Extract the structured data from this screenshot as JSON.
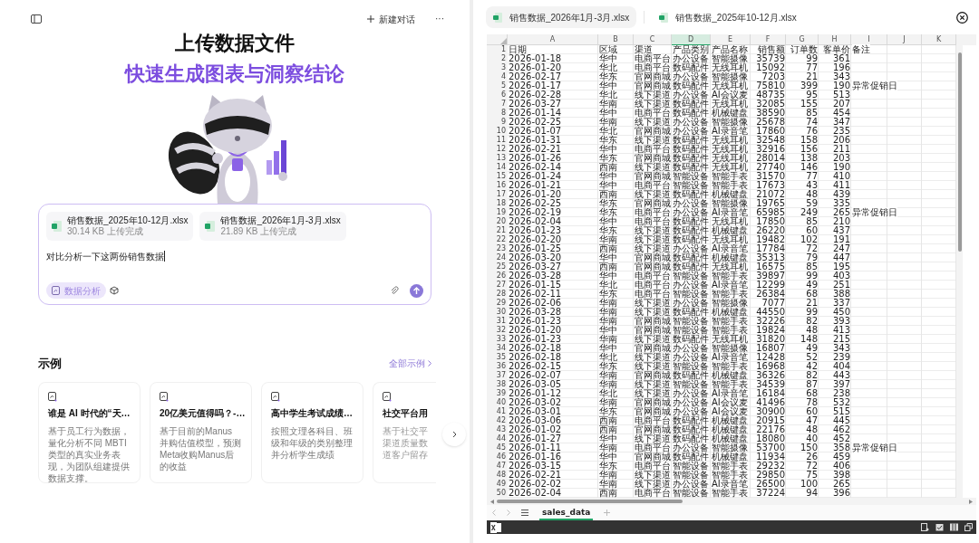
{
  "header": {
    "new_chat": "新建对话",
    "more": "···"
  },
  "hero": {
    "title": "上传数据文件",
    "subtitle": "快速生成图表与洞察结论"
  },
  "composer": {
    "files": [
      {
        "name": "销售数据_2025年10-12月.xlsx",
        "status": "30.14 KB 上传完成"
      },
      {
        "name": "销售数据_2026年1月-3月.xlsx",
        "status": "21.89 KB 上传完成"
      }
    ],
    "message": "对比分析一下这两份销售数据",
    "mode": {
      "label": "数据分析",
      "selected": true
    }
  },
  "examples": {
    "title": "示例",
    "all_link": "全部示例",
    "cards": [
      {
        "title": "谁是 AI 时代的“天…",
        "description": "基于员工行为数据，量化分析不同 MBTI 类型的真实业务表现，为团队组建提供数据支撑。"
      },
      {
        "title": "20亿美元值得吗？-…",
        "description": "基于目前的Manus 并购估值模型，预测Meta收购Manus后的收益"
      },
      {
        "title": "高中学生考试成绩…",
        "description": "按照文理各科目、班级和年级的类别整理并分析学生成绩"
      },
      {
        "title": "社交平台用",
        "description_lines": [
          "基于社交平",
          "渠道质量数",
          "道客户留存"
        ]
      }
    ]
  },
  "viewer": {
    "tabs": [
      {
        "label": "销售数据_2026年1月-3月.xlsx",
        "selected": true
      },
      {
        "label": "销售数据_2025年10-12月.xlsx",
        "selected": false
      }
    ],
    "sheet": {
      "columns": [
        {
          "label": "A",
          "selected": false
        },
        {
          "label": "B",
          "selected": false
        },
        {
          "label": "C",
          "selected": false
        },
        {
          "label": "D",
          "selected": true
        },
        {
          "label": "E",
          "selected": false
        },
        {
          "label": "F",
          "selected": false
        },
        {
          "label": "G",
          "selected": false
        },
        {
          "label": "H",
          "selected": false
        },
        {
          "label": "I",
          "selected": false
        },
        {
          "label": "J",
          "selected": false
        },
        {
          "label": "K",
          "selected": false
        }
      ],
      "rows": [
        {
          "n": "1",
          "cells": [
            "日期",
            "区域",
            "渠道",
            "产品类别",
            "产品名称",
            "销售额",
            "订单数",
            "客单价",
            "备注"
          ]
        },
        {
          "n": "2",
          "cells": [
            "2026-01-18",
            "华中",
            "电商平台",
            "办公设备",
            "智能摄像",
            "35739",
            "99",
            "361"
          ]
        },
        {
          "n": "3",
          "cells": [
            "2026-01-20",
            "华北",
            "电商平台",
            "数码配件",
            "无线耳机",
            "15092",
            "77",
            "196"
          ]
        },
        {
          "n": "4",
          "cells": [
            "2026-02-17",
            "华东",
            "官网商城",
            "办公设备",
            "智能摄像",
            "7203",
            "21",
            "343"
          ]
        },
        {
          "n": "5",
          "cells": [
            "2026-01-17",
            "华中",
            "官网商城",
            "数码配件",
            "无线耳机",
            "75810",
            "399",
            "190",
            "异常促销日"
          ]
        },
        {
          "n": "6",
          "cells": [
            "2026-02-28",
            "华北",
            "线下渠道",
            "办公设备",
            "AI会议麦",
            "48735",
            "95",
            "513"
          ]
        },
        {
          "n": "7",
          "cells": [
            "2026-03-27",
            "华南",
            "线下渠道",
            "数码配件",
            "无线耳机",
            "32085",
            "155",
            "207"
          ]
        },
        {
          "n": "8",
          "cells": [
            "2026-01-14",
            "华中",
            "电商平台",
            "数码配件",
            "机械键盘",
            "38590",
            "85",
            "454"
          ]
        },
        {
          "n": "9",
          "cells": [
            "2026-02-25",
            "华南",
            "线下渠道",
            "办公设备",
            "智能摄像",
            "25678",
            "74",
            "347"
          ]
        },
        {
          "n": "10",
          "cells": [
            "2026-01-07",
            "华北",
            "官网商城",
            "办公设备",
            "AI录音笔",
            "17860",
            "76",
            "235"
          ]
        },
        {
          "n": "11",
          "cells": [
            "2026-01-31",
            "华东",
            "线下渠道",
            "数码配件",
            "无线耳机",
            "32548",
            "158",
            "206"
          ]
        },
        {
          "n": "12",
          "cells": [
            "2026-02-21",
            "华中",
            "电商平台",
            "数码配件",
            "无线耳机",
            "32916",
            "156",
            "211"
          ]
        },
        {
          "n": "13",
          "cells": [
            "2026-01-26",
            "华东",
            "官网商城",
            "数码配件",
            "无线耳机",
            "28014",
            "138",
            "203"
          ]
        },
        {
          "n": "14",
          "cells": [
            "2026-02-14",
            "西南",
            "线下渠道",
            "数码配件",
            "无线耳机",
            "27740",
            "146",
            "190"
          ]
        },
        {
          "n": "15",
          "cells": [
            "2026-01-24",
            "华中",
            "官网商城",
            "智能设备",
            "智能手表",
            "31570",
            "77",
            "410"
          ]
        },
        {
          "n": "16",
          "cells": [
            "2026-01-21",
            "华中",
            "电商平台",
            "智能设备",
            "智能手表",
            "17673",
            "43",
            "411"
          ]
        },
        {
          "n": "17",
          "cells": [
            "2026-01-20",
            "西南",
            "线下渠道",
            "数码配件",
            "机械键盘",
            "21072",
            "48",
            "439"
          ]
        },
        {
          "n": "18",
          "cells": [
            "2026-02-25",
            "华东",
            "官网商城",
            "办公设备",
            "智能摄像",
            "19765",
            "59",
            "335"
          ]
        },
        {
          "n": "19",
          "cells": [
            "2026-02-19",
            "华东",
            "电商平台",
            "办公设备",
            "AI录音笔",
            "65985",
            "249",
            "265",
            "异常促销日"
          ]
        },
        {
          "n": "20",
          "cells": [
            "2026-02-04",
            "华中",
            "电商平台",
            "数码配件",
            "无线耳机",
            "17850",
            "85",
            "210"
          ]
        },
        {
          "n": "21",
          "cells": [
            "2026-01-23",
            "华东",
            "线下渠道",
            "数码配件",
            "机械键盘",
            "26220",
            "60",
            "437"
          ]
        },
        {
          "n": "22",
          "cells": [
            "2026-02-20",
            "华南",
            "线下渠道",
            "数码配件",
            "无线耳机",
            "19482",
            "102",
            "191"
          ]
        },
        {
          "n": "23",
          "cells": [
            "2026-01-25",
            "西南",
            "线下渠道",
            "办公设备",
            "AI录音笔",
            "17784",
            "72",
            "247"
          ]
        },
        {
          "n": "24",
          "cells": [
            "2026-03-20",
            "华中",
            "官网商城",
            "数码配件",
            "机械键盘",
            "35313",
            "79",
            "447"
          ]
        },
        {
          "n": "25",
          "cells": [
            "2026-03-27",
            "西南",
            "官网商城",
            "数码配件",
            "无线耳机",
            "16575",
            "85",
            "195"
          ]
        },
        {
          "n": "26",
          "cells": [
            "2026-03-28",
            "华中",
            "电商平台",
            "智能设备",
            "智能手表",
            "39897",
            "99",
            "403"
          ]
        },
        {
          "n": "27",
          "cells": [
            "2026-01-15",
            "华北",
            "电商平台",
            "办公设备",
            "AI录音笔",
            "12299",
            "49",
            "251"
          ]
        },
        {
          "n": "28",
          "cells": [
            "2026-02-11",
            "华东",
            "电商平台",
            "智能设备",
            "智能手表",
            "26384",
            "68",
            "388"
          ]
        },
        {
          "n": "29",
          "cells": [
            "2026-02-06",
            "华南",
            "线下渠道",
            "办公设备",
            "智能摄像",
            "7077",
            "21",
            "337"
          ]
        },
        {
          "n": "30",
          "cells": [
            "2026-03-28",
            "华南",
            "线下渠道",
            "数码配件",
            "机械键盘",
            "44550",
            "99",
            "450"
          ]
        },
        {
          "n": "31",
          "cells": [
            "2026-01-23",
            "华南",
            "官网商城",
            "智能设备",
            "智能手表",
            "32226",
            "82",
            "393"
          ]
        },
        {
          "n": "32",
          "cells": [
            "2026-01-20",
            "华中",
            "官网商城",
            "智能设备",
            "智能手表",
            "19824",
            "48",
            "413"
          ]
        },
        {
          "n": "33",
          "cells": [
            "2026-01-23",
            "华南",
            "线下渠道",
            "数码配件",
            "无线耳机",
            "31820",
            "148",
            "215"
          ]
        },
        {
          "n": "34",
          "cells": [
            "2026-02-18",
            "华中",
            "官网商城",
            "办公设备",
            "智能摄像",
            "16807",
            "49",
            "343"
          ]
        },
        {
          "n": "35",
          "cells": [
            "2026-02-18",
            "华北",
            "线下渠道",
            "办公设备",
            "AI录音笔",
            "12428",
            "52",
            "239"
          ]
        },
        {
          "n": "36",
          "cells": [
            "2026-02-15",
            "华东",
            "线下渠道",
            "智能设备",
            "智能手表",
            "16968",
            "42",
            "404"
          ]
        },
        {
          "n": "37",
          "cells": [
            "2026-02-07",
            "华南",
            "官网商城",
            "数码配件",
            "机械键盘",
            "36326",
            "82",
            "443"
          ]
        },
        {
          "n": "38",
          "cells": [
            "2026-03-05",
            "华南",
            "线下渠道",
            "智能设备",
            "智能手表",
            "34539",
            "87",
            "397"
          ]
        },
        {
          "n": "39",
          "cells": [
            "2026-01-12",
            "华北",
            "线下渠道",
            "办公设备",
            "AI录音笔",
            "16184",
            "68",
            "238"
          ]
        },
        {
          "n": "40",
          "cells": [
            "2026-03-02",
            "华南",
            "官网商城",
            "办公设备",
            "AI会议麦",
            "41496",
            "78",
            "532"
          ]
        },
        {
          "n": "41",
          "cells": [
            "2026-03-01",
            "华东",
            "官网商城",
            "办公设备",
            "AI会议麦",
            "30900",
            "60",
            "515"
          ]
        },
        {
          "n": "42",
          "cells": [
            "2026-03-06",
            "西南",
            "电商平台",
            "数码配件",
            "机械键盘",
            "20915",
            "47",
            "445"
          ]
        },
        {
          "n": "43",
          "cells": [
            "2026-01-02",
            "西南",
            "官网商城",
            "数码配件",
            "机械键盘",
            "22176",
            "48",
            "462"
          ]
        },
        {
          "n": "44",
          "cells": [
            "2026-01-27",
            "华中",
            "线下渠道",
            "数码配件",
            "机械键盘",
            "18080",
            "40",
            "452"
          ]
        },
        {
          "n": "45",
          "cells": [
            "2026-01-11",
            "华南",
            "电商平台",
            "办公设备",
            "智能摄像",
            "53700",
            "150",
            "358",
            "异常促销日"
          ]
        },
        {
          "n": "46",
          "cells": [
            "2026-01-16",
            "华中",
            "官网商城",
            "数码配件",
            "机械键盘",
            "11934",
            "26",
            "459"
          ]
        },
        {
          "n": "47",
          "cells": [
            "2026-03-15",
            "华东",
            "电商平台",
            "智能设备",
            "智能手表",
            "29232",
            "72",
            "406"
          ]
        },
        {
          "n": "48",
          "cells": [
            "2026-02-21",
            "华南",
            "线下渠道",
            "智能设备",
            "智能手表",
            "29850",
            "75",
            "398"
          ]
        },
        {
          "n": "49",
          "cells": [
            "2026-02-02",
            "华南",
            "线下渠道",
            "办公设备",
            "AI录音笔",
            "26500",
            "100",
            "265"
          ]
        },
        {
          "n": "50",
          "cells": [
            "2026-02-04",
            "西南",
            "电商平台",
            "智能设备",
            "智能手表",
            "37224",
            "94",
            "396"
          ]
        }
      ],
      "sheet_tabs": [
        {
          "label": "sales_data",
          "selected": true
        }
      ]
    }
  }
}
